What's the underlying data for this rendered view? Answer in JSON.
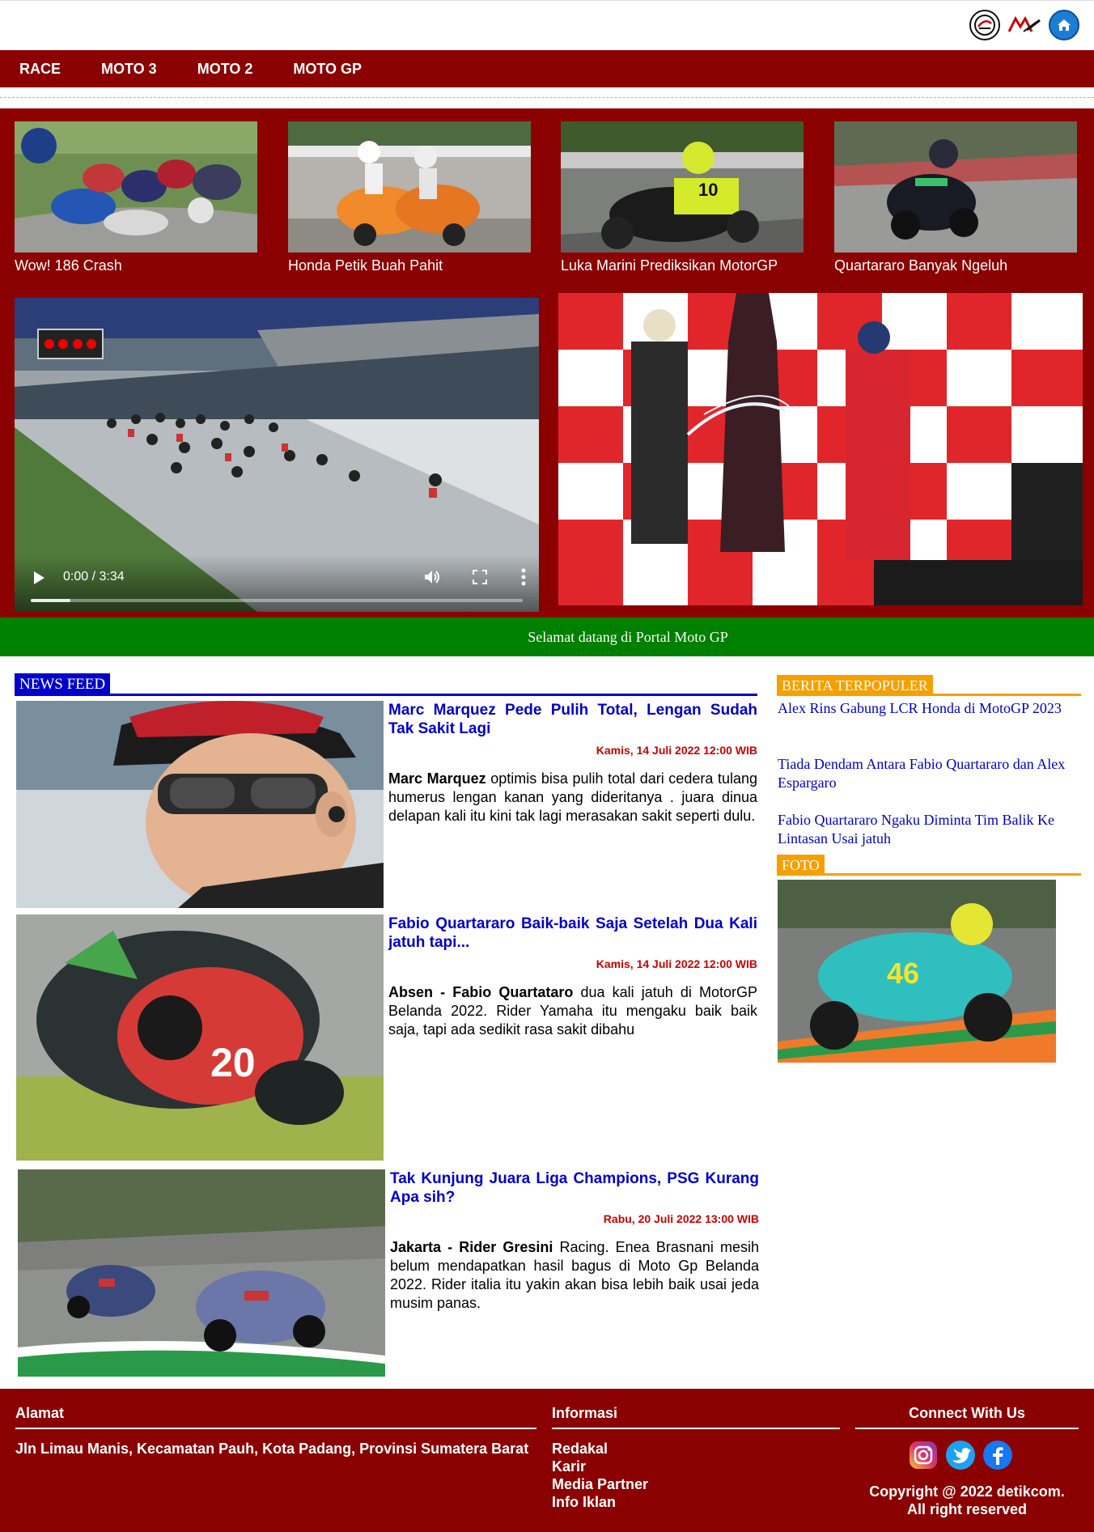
{
  "nav": {
    "items": [
      "RACE",
      "MOTO 3",
      "MOTO 2",
      "MOTO GP"
    ]
  },
  "top_icons": [
    "moto1-logo-icon",
    "motogp-logo-icon",
    "home-icon"
  ],
  "headlines": [
    {
      "caption": "Wow! 186 Crash"
    },
    {
      "caption": "Honda Petik Buah Pahit"
    },
    {
      "caption": "Luka Marini Prediksikan MotorGP"
    },
    {
      "caption": "Quartararo Banyak Ngeluh"
    }
  ],
  "video": {
    "time": "0:00 / 3:34",
    "progress": 0.08
  },
  "welcome": "Selamat datang di Portal Moto GP",
  "news_feed": {
    "label": "NEWS FEED",
    "articles": [
      {
        "title": "Marc Marquez Pede Pulih Total, Lengan Sudah Tak Sakit Lagi",
        "date": "Kamis, 14 Juli 2022 12:00 WIB",
        "lead": "Marc Marquez",
        "text": " optimis bisa pulih total dari cedera tulang humerus lengan kanan yang dideritanya . juara dinua delapan kali itu kini tak lagi merasakan sakit seperti dulu."
      },
      {
        "title": "Fabio Quartararo Baik-baik Saja Setelah Dua Kali jatuh tapi...",
        "date": "Kamis, 14 Juli 2022 12:00 WIB",
        "lead": "Absen - Fabio Quartataro",
        "text": " dua kali jatuh di MotorGP Belanda 2022. Rider Yamaha itu mengaku baik baik saja, tapi ada sedikit rasa sakit dibahu"
      },
      {
        "title": "Tak Kunjung Juara Liga Champions, PSG Kurang Apa sih?",
        "date": "Rabu, 20 Juli 2022 13:00 WIB",
        "lead": "Jakarta - Rider Gresini",
        "text": " Racing. Enea Brasnani mesih belum mendapatkan hasil bagus di Moto Gp Belanda 2022. Rider italia itu yakin akan bisa lebih baik usai jeda musim panas."
      }
    ]
  },
  "sidebar": {
    "popular_label": "BERITA TERPOPULER",
    "popular": [
      "Alex Rins Gabung LCR Honda di MotoGP 2023",
      "Tiada Dendam Antara Fabio Quartararo dan Alex Espargaro",
      "Fabio Quartararo Ngaku Diminta Tim Balik Ke Lintasan Usai jatuh"
    ],
    "photo_label": "FOTO"
  },
  "footer": {
    "address_heading": "Alamat",
    "address": "Jln Limau Manis, Kecamatan Pauh, Kota Padang, Provinsi Sumatera Barat",
    "info_heading": "Informasi",
    "info_links": [
      "Redakal",
      "Karir",
      "Media Partner",
      "Info Iklan"
    ],
    "connect_heading": "Connect With Us",
    "copyright_1": "Copyright @ 2022 detikcom.",
    "copyright_2": "All right reserved"
  },
  "colors": {
    "brand_red": "#8b0000",
    "welcome_green": "#008000",
    "feed_blue": "#0000cc",
    "sidebar_orange": "#f5a000",
    "date_red": "#cc0000"
  }
}
